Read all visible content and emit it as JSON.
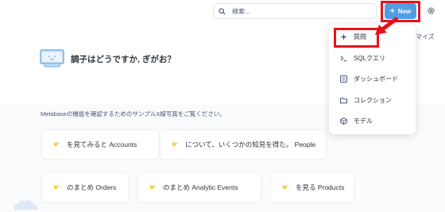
{
  "header": {
    "search_placeholder": "検索...",
    "new_label": "New",
    "new_plus": "+"
  },
  "partially_hidden_text": "マイズ",
  "greeting": "調子はどうですか, ぎがお？",
  "intro_text": "Metabaseの機能を確認するためのサンプルX線写真をご覧ください。",
  "cards": [
    {
      "label": "を見てみると Accounts"
    },
    {
      "label": "について、いくつかの知見を得た。 People"
    },
    {
      "label": "のまとめ Orders"
    },
    {
      "label": "のまとめ Analytic Events"
    },
    {
      "label": "を見る Products"
    }
  ],
  "new_menu": {
    "items": [
      {
        "label": "質問",
        "icon": "sparkle-icon"
      },
      {
        "label": "SQLクエリ",
        "icon": "terminal-icon"
      },
      {
        "label": "ダッシュボード",
        "icon": "dashboard-icon"
      },
      {
        "label": "コレクション",
        "icon": "folder-icon"
      },
      {
        "label": "モデル",
        "icon": "model-icon"
      }
    ]
  },
  "colors": {
    "accent": "#509ee3",
    "highlight": "#e8121b",
    "hand": "#f9cf48"
  }
}
